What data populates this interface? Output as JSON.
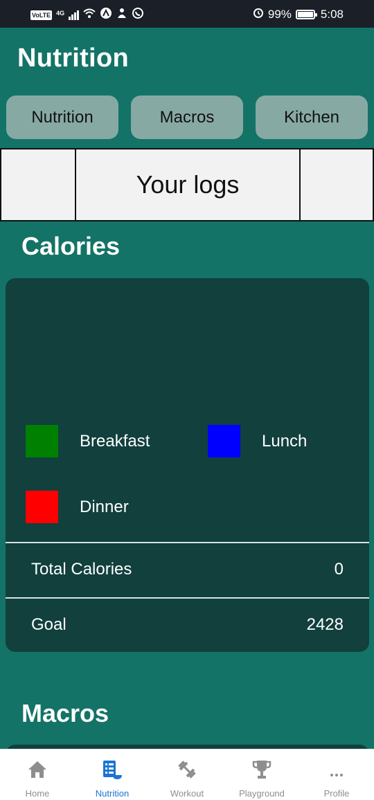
{
  "status_bar": {
    "volte": "VoLTE",
    "network": "4G",
    "battery_percent": "99%",
    "battery_level": 0.99,
    "time": "5:08"
  },
  "header": {
    "title": "Nutrition"
  },
  "tabs": [
    {
      "label": "Nutrition"
    },
    {
      "label": "Macros"
    },
    {
      "label": "Kitchen"
    }
  ],
  "logs_bar": {
    "title": "Your logs"
  },
  "calories": {
    "section_title": "Calories",
    "legend": [
      {
        "label": "Breakfast",
        "color": "#008000"
      },
      {
        "label": "Lunch",
        "color": "#0000ff"
      },
      {
        "label": "Dinner",
        "color": "#ff0000"
      }
    ],
    "total_label": "Total Calories",
    "total_value": "0",
    "goal_label": "Goal",
    "goal_value": "2428"
  },
  "macros": {
    "section_title": "Macros"
  },
  "bottom_nav": {
    "items": [
      {
        "label": "Home",
        "icon": "home-icon"
      },
      {
        "label": "Nutrition",
        "icon": "nutrition-icon",
        "active": true
      },
      {
        "label": "Workout",
        "icon": "dumbbell-icon"
      },
      {
        "label": "Playground",
        "icon": "trophy-icon"
      },
      {
        "label": "Profile",
        "icon": "more-icon"
      }
    ],
    "active_color": "#1b74d1",
    "inactive_color": "#8e8e8e"
  }
}
